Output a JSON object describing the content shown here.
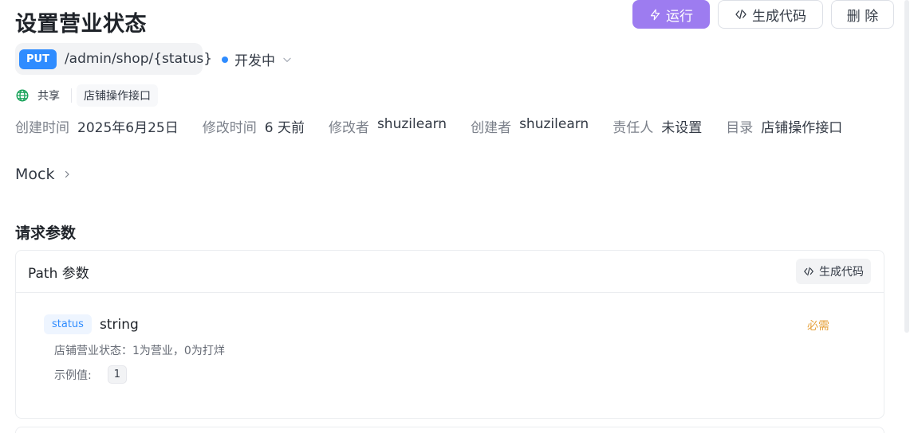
{
  "page": {
    "title": "设置营业状态"
  },
  "actions": {
    "run_label": "运行",
    "generate_label": "生成代码",
    "delete_label": "删 除",
    "run_color": "#9d7cf0"
  },
  "endpoint": {
    "method": "PUT",
    "path": "/admin/shop/{status}",
    "status": "开发中",
    "method_color": "#2f8cff"
  },
  "share": {
    "label": "共享",
    "folder_tag": "店铺操作接口"
  },
  "meta": {
    "created_label": "创建时间",
    "created_value": "2025年6月25日",
    "modified_label": "修改时间",
    "modified_value": "6 天前",
    "modifier_label": "修改者",
    "modifier_value": "shuzilearn",
    "creator_label": "创建者",
    "creator_value": "shuzilearn",
    "owner_label": "责任人",
    "owner_value": "未设置",
    "folder_label": "目录",
    "folder_value": "店铺操作接口"
  },
  "mock": {
    "label": "Mock"
  },
  "request": {
    "section_title": "请求参数",
    "path_card": {
      "title": "Path 参数",
      "generate_label": "生成代码",
      "params": [
        {
          "name": "status",
          "type": "string",
          "required": "必需",
          "description": "店铺营业状态：1为营业，0为打烊",
          "example_label": "示例值:",
          "example_value": "1"
        }
      ]
    }
  }
}
